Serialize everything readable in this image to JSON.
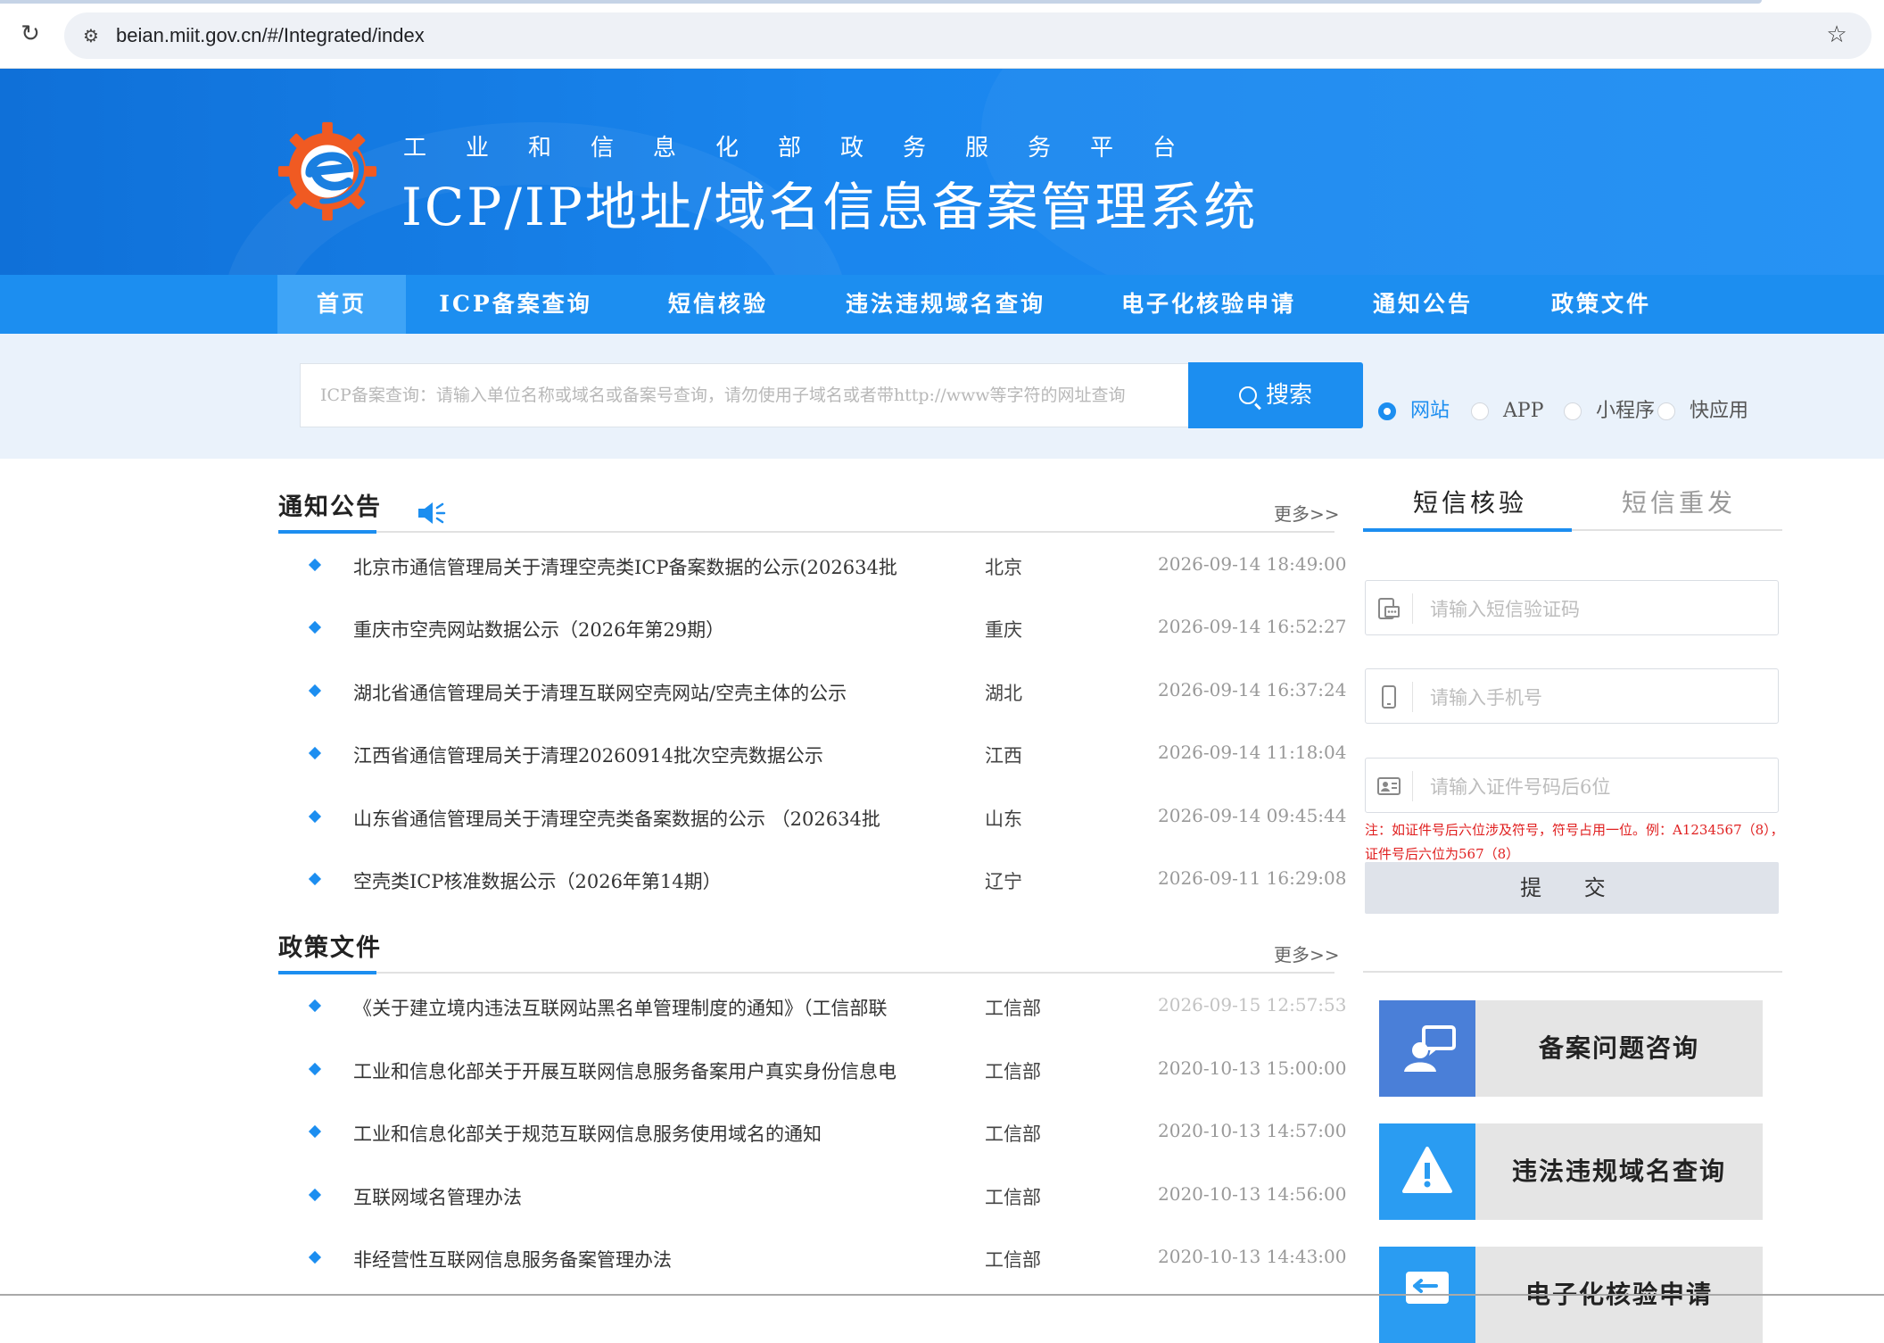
{
  "browser": {
    "url": "beian.miit.gov.cn/#/Integrated/index"
  },
  "header": {
    "subtitle": "工业和信息化部政务服务平台",
    "title": "ICP/IP地址/域名信息备案管理系统"
  },
  "nav": {
    "items": [
      {
        "label": "首页"
      },
      {
        "label": "ICP备案查询"
      },
      {
        "label": "短信核验"
      },
      {
        "label": "违法违规域名查询"
      },
      {
        "label": "电子化核验申请"
      },
      {
        "label": "通知公告"
      },
      {
        "label": "政策文件"
      }
    ]
  },
  "search": {
    "placeholder": "ICP备案查询：请输入单位名称或域名或备案号查询，请勿使用子域名或者带http://www等字符的网址查询",
    "button_label": "搜索",
    "options": [
      {
        "label": "网站",
        "checked": true
      },
      {
        "label": "APP",
        "checked": false
      },
      {
        "label": "小程序",
        "checked": false
      },
      {
        "label": "快应用",
        "checked": false
      }
    ]
  },
  "notices": {
    "title": "通知公告",
    "more": "更多>>",
    "items": [
      {
        "title": "北京市通信管理局关于清理空壳类ICP备案数据的公示(202634批",
        "region": "北京",
        "time": "2026-09-14 18:49:00"
      },
      {
        "title": "重庆市空壳网站数据公示（2026年第29期）",
        "region": "重庆",
        "time": "2026-09-14 16:52:27"
      },
      {
        "title": "湖北省通信管理局关于清理互联网空壳网站/空壳主体的公示",
        "region": "湖北",
        "time": "2026-09-14 16:37:24"
      },
      {
        "title": "江西省通信管理局关于清理20260914批次空壳数据公示",
        "region": "江西",
        "time": "2026-09-14 11:18:04"
      },
      {
        "title": "山东省通信管理局关于清理空壳类备案数据的公示 （202634批",
        "region": "山东",
        "time": "2026-09-14 09:45:44"
      },
      {
        "title": "空壳类ICP核准数据公示（2026年第14期）",
        "region": "辽宁",
        "time": "2026-09-11 16:29:08"
      }
    ]
  },
  "policies": {
    "title": "政策文件",
    "more": "更多>>",
    "items": [
      {
        "title": "《关于建立境内违法互联网站黑名单管理制度的通知》（工信部联",
        "region": "工信部",
        "time": "2026-09-15 12:57:53"
      },
      {
        "title": "工业和信息化部关于开展互联网信息服务备案用户真实身份信息电",
        "region": "工信部",
        "time": "2020-10-13 15:00:00"
      },
      {
        "title": "工业和信息化部关于规范互联网信息服务使用域名的通知",
        "region": "工信部",
        "time": "2020-10-13 14:57:00"
      },
      {
        "title": "互联网域名管理办法",
        "region": "工信部",
        "time": "2020-10-13 14:56:00"
      },
      {
        "title": "非经营性互联网信息服务备案管理办法",
        "region": "工信部",
        "time": "2020-10-13 14:43:00"
      }
    ]
  },
  "sms": {
    "tabs": [
      {
        "label": "短信核验"
      },
      {
        "label": "短信重发"
      }
    ],
    "fields": [
      {
        "placeholder": "请输入短信验证码",
        "icon": "sms-code-icon"
      },
      {
        "placeholder": "请输入手机号",
        "icon": "phone-icon"
      },
      {
        "placeholder": "请输入证件号码后6位",
        "icon": "id-card-icon"
      }
    ],
    "note": "注：如证件号后六位涉及符号，符号占用一位。例：A1234567（8），证件号后六位为567（8）",
    "submit_label": "提 交"
  },
  "quick_links": [
    {
      "label": "备案问题咨询",
      "icon": "consult-icon",
      "color": "#4a7fd8"
    },
    {
      "label": "违法违规域名查询",
      "icon": "warning-icon",
      "color": "#2a9cf2"
    },
    {
      "label": "电子化核验申请",
      "icon": "back-arrow-icon",
      "color": "#2a9cf2"
    }
  ],
  "colors": {
    "primary": "#1c8ef0",
    "header_dark": "#0f70d8",
    "logo_orange": "#f05a22"
  }
}
